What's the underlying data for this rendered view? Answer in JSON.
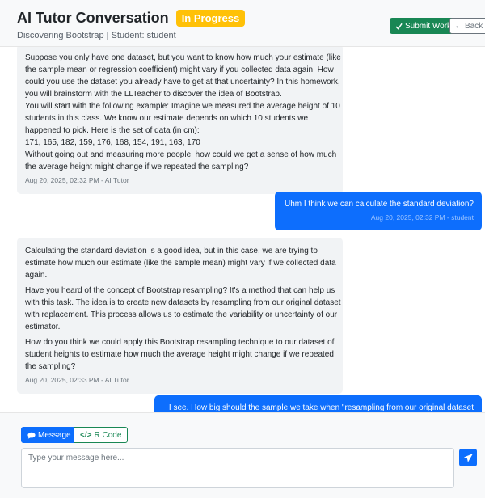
{
  "header": {
    "title": "AI Tutor Conversation",
    "status_badge": "In Progress",
    "subtitle": "Discovering Bootstrap | Student: student",
    "submit_label": "Submit Work",
    "back_label": "Back"
  },
  "messages": [
    {
      "role": "ai",
      "lines": [
        "Suppose you only have one dataset, but you want to know how much your estimate (like",
        "the sample mean or regression coefficient) might vary if you collected data again. How",
        "could you use the dataset you already have to get at that uncertainty? In this homework,",
        "you will brainstorm with the LLTeacher to discover the idea of Bootstrap.",
        "You will start with the following example: Imagine we measured the average height of 10",
        "students in this class. We know our estimate depends on which 10 students we",
        "happened to pick. Here is the set of data (in cm):",
        "171, 165, 182, 159, 176, 168, 154, 191, 163, 170",
        "Without going out and measuring more people, how could we get a sense of how much",
        "the average height might change if we repeated the sampling?"
      ],
      "meta": "Aug 20, 2025, 02:32 PM - AI Tutor"
    },
    {
      "role": "user",
      "text": "Uhm I think we can calculate the standard deviation?",
      "meta": "Aug 20, 2025, 02:32 PM - student"
    },
    {
      "role": "ai",
      "paragraphs": [
        [
          "Calculating the standard deviation is a good idea, but in this case, we are trying to",
          "estimate how much our estimate (like the sample mean) might vary if we collected data",
          "again."
        ],
        [
          "Have you heard of the concept of Bootstrap resampling? It's a method that can help us",
          "with this task. The idea is to create new datasets by resampling from our original dataset",
          "with replacement. This process allows us to estimate the variability or uncertainty of our",
          "estimator."
        ],
        [
          "How do you think we could apply this Bootstrap resampling technique to our dataset of",
          "student heights to estimate how much the average height might change if we repeated",
          "the sampling?"
        ]
      ],
      "meta": "Aug 20, 2025, 02:33 PM - AI Tutor"
    },
    {
      "role": "user",
      "text": "I see. How big should the sample we take when \"resampling from our original dataset"
    }
  ],
  "composer": {
    "message_tab": "Message",
    "code_tab": "R Code",
    "placeholder": "Type your message here..."
  },
  "colors": {
    "primary": "#0d6efd",
    "success": "#198754",
    "warning": "#ffc107"
  }
}
